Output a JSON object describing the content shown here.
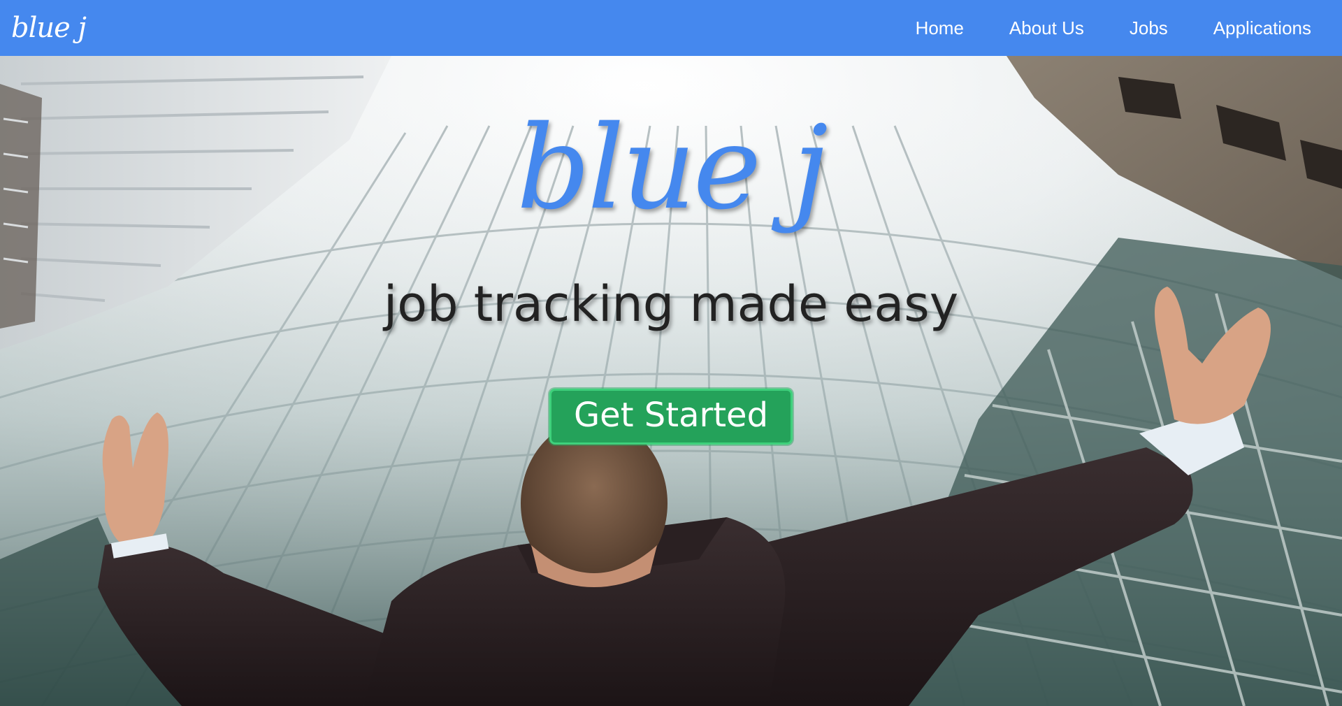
{
  "navbar": {
    "brand": "blue j",
    "links": [
      {
        "label": "Home"
      },
      {
        "label": "About Us"
      },
      {
        "label": "Jobs"
      },
      {
        "label": "Applications"
      }
    ],
    "background_color": "#4588ee"
  },
  "hero": {
    "title": "blue j",
    "subtitle": "job tracking made easy",
    "cta_label": "Get Started",
    "title_color": "#4588ee",
    "cta_color": "#24a25a"
  }
}
